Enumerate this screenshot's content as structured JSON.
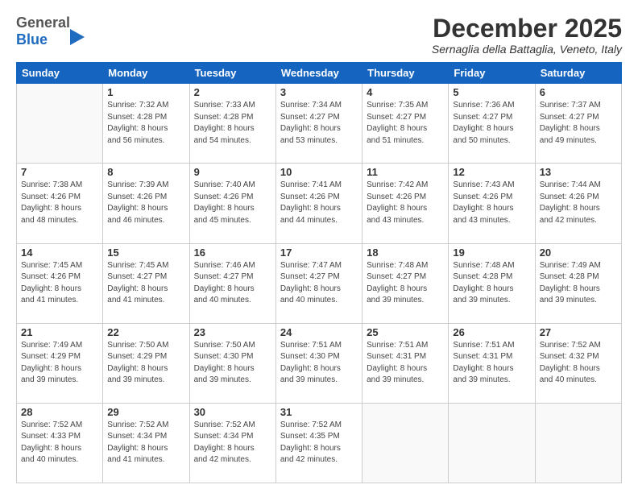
{
  "header": {
    "logo_general": "General",
    "logo_blue": "Blue",
    "month_title": "December 2025",
    "location": "Sernaglia della Battaglia, Veneto, Italy"
  },
  "days_of_week": [
    "Sunday",
    "Monday",
    "Tuesday",
    "Wednesday",
    "Thursday",
    "Friday",
    "Saturday"
  ],
  "weeks": [
    [
      {
        "day": "",
        "info": ""
      },
      {
        "day": "1",
        "info": "Sunrise: 7:32 AM\nSunset: 4:28 PM\nDaylight: 8 hours\nand 56 minutes."
      },
      {
        "day": "2",
        "info": "Sunrise: 7:33 AM\nSunset: 4:28 PM\nDaylight: 8 hours\nand 54 minutes."
      },
      {
        "day": "3",
        "info": "Sunrise: 7:34 AM\nSunset: 4:27 PM\nDaylight: 8 hours\nand 53 minutes."
      },
      {
        "day": "4",
        "info": "Sunrise: 7:35 AM\nSunset: 4:27 PM\nDaylight: 8 hours\nand 51 minutes."
      },
      {
        "day": "5",
        "info": "Sunrise: 7:36 AM\nSunset: 4:27 PM\nDaylight: 8 hours\nand 50 minutes."
      },
      {
        "day": "6",
        "info": "Sunrise: 7:37 AM\nSunset: 4:27 PM\nDaylight: 8 hours\nand 49 minutes."
      }
    ],
    [
      {
        "day": "7",
        "info": "Sunrise: 7:38 AM\nSunset: 4:26 PM\nDaylight: 8 hours\nand 48 minutes."
      },
      {
        "day": "8",
        "info": "Sunrise: 7:39 AM\nSunset: 4:26 PM\nDaylight: 8 hours\nand 46 minutes."
      },
      {
        "day": "9",
        "info": "Sunrise: 7:40 AM\nSunset: 4:26 PM\nDaylight: 8 hours\nand 45 minutes."
      },
      {
        "day": "10",
        "info": "Sunrise: 7:41 AM\nSunset: 4:26 PM\nDaylight: 8 hours\nand 44 minutes."
      },
      {
        "day": "11",
        "info": "Sunrise: 7:42 AM\nSunset: 4:26 PM\nDaylight: 8 hours\nand 43 minutes."
      },
      {
        "day": "12",
        "info": "Sunrise: 7:43 AM\nSunset: 4:26 PM\nDaylight: 8 hours\nand 43 minutes."
      },
      {
        "day": "13",
        "info": "Sunrise: 7:44 AM\nSunset: 4:26 PM\nDaylight: 8 hours\nand 42 minutes."
      }
    ],
    [
      {
        "day": "14",
        "info": "Sunrise: 7:45 AM\nSunset: 4:26 PM\nDaylight: 8 hours\nand 41 minutes."
      },
      {
        "day": "15",
        "info": "Sunrise: 7:45 AM\nSunset: 4:27 PM\nDaylight: 8 hours\nand 41 minutes."
      },
      {
        "day": "16",
        "info": "Sunrise: 7:46 AM\nSunset: 4:27 PM\nDaylight: 8 hours\nand 40 minutes."
      },
      {
        "day": "17",
        "info": "Sunrise: 7:47 AM\nSunset: 4:27 PM\nDaylight: 8 hours\nand 40 minutes."
      },
      {
        "day": "18",
        "info": "Sunrise: 7:48 AM\nSunset: 4:27 PM\nDaylight: 8 hours\nand 39 minutes."
      },
      {
        "day": "19",
        "info": "Sunrise: 7:48 AM\nSunset: 4:28 PM\nDaylight: 8 hours\nand 39 minutes."
      },
      {
        "day": "20",
        "info": "Sunrise: 7:49 AM\nSunset: 4:28 PM\nDaylight: 8 hours\nand 39 minutes."
      }
    ],
    [
      {
        "day": "21",
        "info": "Sunrise: 7:49 AM\nSunset: 4:29 PM\nDaylight: 8 hours\nand 39 minutes."
      },
      {
        "day": "22",
        "info": "Sunrise: 7:50 AM\nSunset: 4:29 PM\nDaylight: 8 hours\nand 39 minutes."
      },
      {
        "day": "23",
        "info": "Sunrise: 7:50 AM\nSunset: 4:30 PM\nDaylight: 8 hours\nand 39 minutes."
      },
      {
        "day": "24",
        "info": "Sunrise: 7:51 AM\nSunset: 4:30 PM\nDaylight: 8 hours\nand 39 minutes."
      },
      {
        "day": "25",
        "info": "Sunrise: 7:51 AM\nSunset: 4:31 PM\nDaylight: 8 hours\nand 39 minutes."
      },
      {
        "day": "26",
        "info": "Sunrise: 7:51 AM\nSunset: 4:31 PM\nDaylight: 8 hours\nand 39 minutes."
      },
      {
        "day": "27",
        "info": "Sunrise: 7:52 AM\nSunset: 4:32 PM\nDaylight: 8 hours\nand 40 minutes."
      }
    ],
    [
      {
        "day": "28",
        "info": "Sunrise: 7:52 AM\nSunset: 4:33 PM\nDaylight: 8 hours\nand 40 minutes."
      },
      {
        "day": "29",
        "info": "Sunrise: 7:52 AM\nSunset: 4:34 PM\nDaylight: 8 hours\nand 41 minutes."
      },
      {
        "day": "30",
        "info": "Sunrise: 7:52 AM\nSunset: 4:34 PM\nDaylight: 8 hours\nand 42 minutes."
      },
      {
        "day": "31",
        "info": "Sunrise: 7:52 AM\nSunset: 4:35 PM\nDaylight: 8 hours\nand 42 minutes."
      },
      {
        "day": "",
        "info": ""
      },
      {
        "day": "",
        "info": ""
      },
      {
        "day": "",
        "info": ""
      }
    ]
  ]
}
